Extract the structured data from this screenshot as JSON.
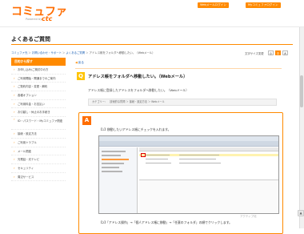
{
  "header": {
    "logo": "コミュファ",
    "logo_sub": "Powered by",
    "logo_etc": "ctc",
    "buttons": [
      "Webメールログイン",
      "Myコミュファログイン"
    ]
  },
  "page_title": "よくあるご質問",
  "breadcrumb": [
    "コミュファ光",
    "お問い合わせ・サポート",
    "よくあるご質問",
    "アドレス帳をフォルダへ移動したい。（Webメール）"
  ],
  "sidebar": {
    "heading": "目的から探す",
    "items": [
      "お申し込み/ご検討中の方",
      "ご利用開始・開通までのご案内",
      "ご契約内容・変更・解約",
      "各種オプション",
      "ご利用料金・お支払い",
      "お引越し・休止のお手続き",
      "ID・パスワード・Myコミュファ関連",
      "接続・設定方法",
      "ご利用トラブル",
      "メール関連",
      "光電話・光テレビ",
      "セキュリティ",
      "周辺サービス"
    ]
  },
  "back_link": "戻る",
  "font_size": {
    "label": "文字サイズ変更",
    "options": [
      "小",
      "中",
      "大"
    ],
    "active": 1
  },
  "question": {
    "mark": "Q",
    "title": "アドレス帳をフォルダへ移動したい。（Webメール）",
    "body": "アドレス帳に登録したアドレスをフォルダへ移動したい。（Webメール）",
    "category": "カテゴリー：　技術的な質問 ＞ 接続・設定方法 ＞ Webメール"
  },
  "answer": {
    "mark": "A",
    "step1": "【1】移動したいアドレス帳にチェックを入れます。",
    "step2": "【2】「アドレス操作」→「個人アドレス帳に移動」→「任意のフォルダ」の順でクリックします。"
  },
  "watermark": "アクティブ化",
  "colors": {
    "brand": "#ff6d00",
    "accent": "#ff8a00",
    "question": "#ffc400",
    "link": "#1a5fb4"
  }
}
